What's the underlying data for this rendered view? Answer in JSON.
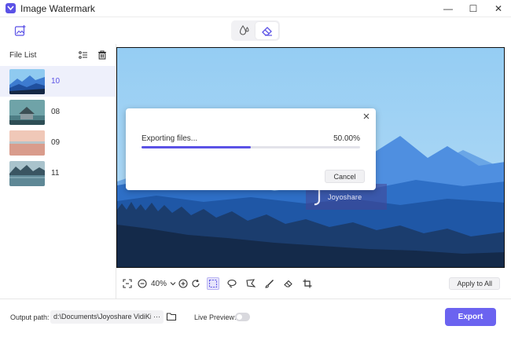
{
  "window": {
    "title": "Image Watermark",
    "controls": [
      "—",
      "☐",
      "✕"
    ]
  },
  "toolbar": {
    "add_image_icon": "add-image-icon",
    "modes": [
      {
        "name": "add-watermark",
        "icon": "droplet-icon",
        "active": false
      },
      {
        "name": "remove-watermark",
        "icon": "eraser-icon",
        "active": true
      }
    ]
  },
  "file_list": {
    "title": "File List",
    "items": [
      {
        "name": "10",
        "selected": true
      },
      {
        "name": "08",
        "selected": false
      },
      {
        "name": "09",
        "selected": false
      },
      {
        "name": "11",
        "selected": false
      }
    ]
  },
  "canvas": {
    "watermark_text": "Joyoshare"
  },
  "edit_toolbar": {
    "zoom": "40%",
    "apply_all_label": "Apply to All"
  },
  "footer": {
    "output_label": "Output path:",
    "output_path": "d:\\Documents\\Joyoshare VidiKit\\Im",
    "output_more": "···",
    "live_preview_label": "Live Preview:",
    "live_preview_on": false,
    "export_label": "Export"
  },
  "dialog": {
    "message": "Exporting files...",
    "percent_label": "50.00%",
    "progress": 0.5,
    "cancel_label": "Cancel"
  },
  "colors": {
    "accent": "#5b52e6",
    "export": "#6b63f0"
  }
}
